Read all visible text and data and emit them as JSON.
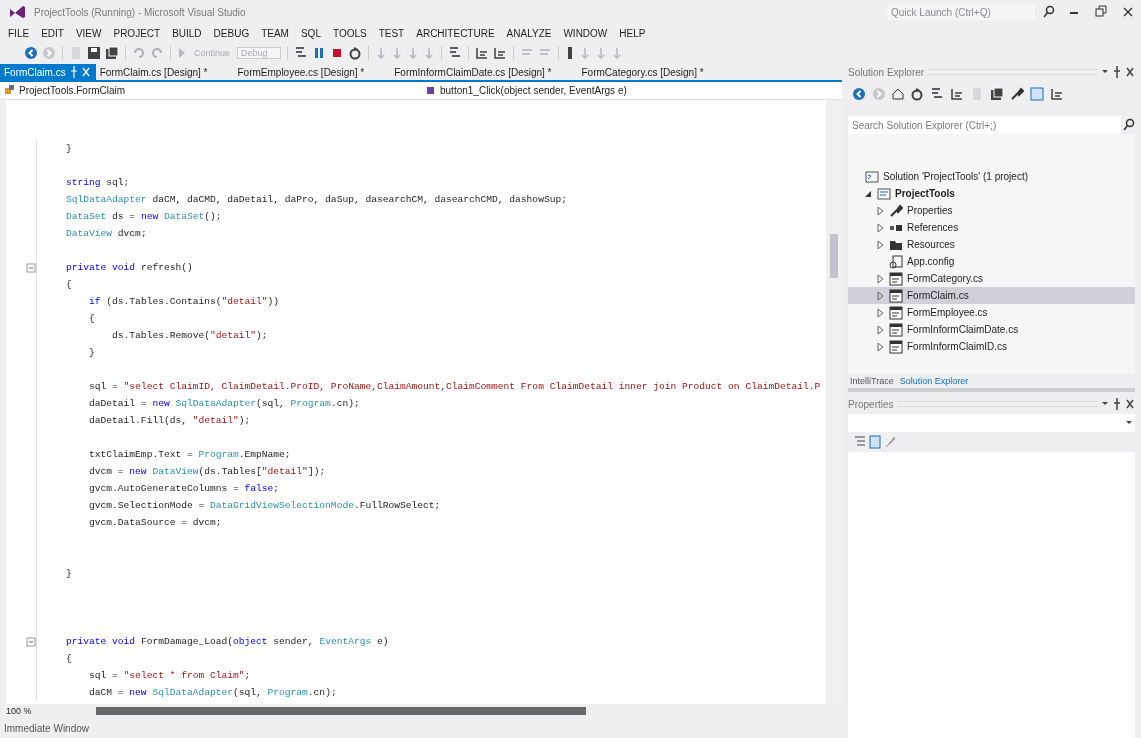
{
  "window": {
    "title": "ProjectTools (Running) - Microsoft Visual Studio",
    "quick_launch": {
      "placeholder": "Quick Launch (Ctrl+Q)"
    }
  },
  "menu": [
    "FILE",
    "EDIT",
    "VIEW",
    "PROJECT",
    "BUILD",
    "DEBUG",
    "TEAM",
    "SQL",
    "TOOLS",
    "TEST",
    "ARCHITECTURE",
    "ANALYZE",
    "WINDOW",
    "HELP"
  ],
  "toolbar": {
    "items": [
      {
        "kind": "back"
      },
      {
        "kind": "forward"
      },
      {
        "kind": "sep"
      },
      {
        "kind": "new"
      },
      {
        "kind": "save"
      },
      {
        "kind": "save-all"
      },
      {
        "kind": "sep"
      },
      {
        "kind": "undo"
      },
      {
        "kind": "redo"
      },
      {
        "kind": "sep"
      },
      {
        "kind": "continue",
        "label": "Continue",
        "disabled": true
      },
      {
        "kind": "combo",
        "label": "Debug",
        "disabled": true
      },
      {
        "kind": "sep"
      },
      {
        "kind": "process"
      },
      {
        "kind": "pause"
      },
      {
        "kind": "stop"
      },
      {
        "kind": "restart"
      },
      {
        "kind": "sep"
      },
      {
        "kind": "step"
      },
      {
        "kind": "step"
      },
      {
        "kind": "step"
      },
      {
        "kind": "step"
      },
      {
        "kind": "sep"
      },
      {
        "kind": "process"
      },
      {
        "kind": "sep"
      },
      {
        "kind": "outline"
      },
      {
        "kind": "outline"
      },
      {
        "kind": "sep"
      },
      {
        "kind": "comment"
      },
      {
        "kind": "comment"
      },
      {
        "kind": "sep"
      },
      {
        "kind": "bookmark"
      },
      {
        "kind": "step"
      },
      {
        "kind": "step"
      },
      {
        "kind": "step"
      }
    ]
  },
  "tabs": [
    {
      "label": "FormClaim.cs",
      "selected": true
    },
    {
      "label": "FormClaim.cs [Design]",
      "selected": false,
      "marker": "*"
    },
    {
      "label": "FormEmployee.cs [Design]",
      "selected": false,
      "marker": "*"
    },
    {
      "label": "FormInformClaimDate.cs [Design]",
      "selected": false,
      "marker": "*"
    },
    {
      "label": "FormCategory.cs [Design]",
      "selected": false,
      "marker": "*"
    }
  ],
  "navigation": {
    "class": "ProjectTools.FormClaim",
    "member": "button1_Click(object sender, EventArgs e)"
  },
  "code_lines": [
    {
      "kind": "code",
      "foldable": false,
      "tokens": [
        {
          "text": "    }",
          "kind": "plain"
        }
      ]
    },
    {
      "kind": "blank"
    },
    {
      "kind": "code",
      "foldable": false,
      "tokens": [
        {
          "text": "    string",
          "kind": "keyword"
        },
        {
          "text": " sql;",
          "kind": "plain"
        }
      ]
    },
    {
      "kind": "code",
      "foldable": false,
      "tokens": [
        {
          "text": "    SqlDataAdapter",
          "kind": "type"
        },
        {
          "text": " daCM, daCMD, daDetail, daPro, daSup, dasearchCM, dasearchCMD, dashowSup;",
          "kind": "plain"
        }
      ]
    },
    {
      "kind": "code",
      "foldable": false,
      "tokens": [
        {
          "text": "    DataSet",
          "kind": "type"
        },
        {
          "text": " ds = ",
          "kind": "plain"
        },
        {
          "text": "new",
          "kind": "keyword"
        },
        {
          "text": " DataSet",
          "kind": "type"
        },
        {
          "text": "();",
          "kind": "plain"
        }
      ]
    },
    {
      "kind": "code",
      "foldable": false,
      "tokens": [
        {
          "text": "    DataView",
          "kind": "type"
        },
        {
          "text": " dvcm;",
          "kind": "plain"
        }
      ]
    },
    {
      "kind": "blank"
    },
    {
      "kind": "code",
      "foldable": true,
      "tokens": [
        {
          "text": "    private void",
          "kind": "keyword"
        },
        {
          "text": " refresh()",
          "kind": "plain"
        }
      ]
    },
    {
      "kind": "code",
      "foldable": false,
      "tokens": [
        {
          "text": "    {",
          "kind": "plain"
        }
      ]
    },
    {
      "kind": "code",
      "foldable": false,
      "tokens": [
        {
          "text": "        if",
          "kind": "keyword"
        },
        {
          "text": " (ds.Tables.Contains(",
          "kind": "plain"
        },
        {
          "text": "\"detail\"",
          "kind": "string"
        },
        {
          "text": "))",
          "kind": "plain"
        }
      ]
    },
    {
      "kind": "code",
      "foldable": false,
      "tokens": [
        {
          "text": "        {",
          "kind": "plain"
        }
      ]
    },
    {
      "kind": "code",
      "foldable": false,
      "tokens": [
        {
          "text": "            ds.Tables.Remove(",
          "kind": "plain"
        },
        {
          "text": "\"detail\"",
          "kind": "string"
        },
        {
          "text": ");",
          "kind": "plain"
        }
      ]
    },
    {
      "kind": "code",
      "foldable": false,
      "tokens": [
        {
          "text": "        }",
          "kind": "plain"
        }
      ]
    },
    {
      "kind": "blank"
    },
    {
      "kind": "code",
      "foldable": false,
      "tokens": [
        {
          "text": "        sql = ",
          "kind": "plain"
        },
        {
          "text": "\"select ClaimID, ClaimDetail.ProID, ProName,ClaimAmount,ClaimComment From ClaimDetail inner join Product on ClaimDetail.P",
          "kind": "string"
        }
      ]
    },
    {
      "kind": "code",
      "foldable": false,
      "tokens": [
        {
          "text": "        daDetail = ",
          "kind": "plain"
        },
        {
          "text": "new",
          "kind": "keyword"
        },
        {
          "text": " SqlDataAdapter",
          "kind": "type"
        },
        {
          "text": "(sql, ",
          "kind": "plain"
        },
        {
          "text": "Program",
          "kind": "type"
        },
        {
          "text": ".cn);",
          "kind": "plain"
        }
      ]
    },
    {
      "kind": "code",
      "foldable": false,
      "tokens": [
        {
          "text": "        daDetail.Fill(ds, ",
          "kind": "plain"
        },
        {
          "text": "\"detail\"",
          "kind": "string"
        },
        {
          "text": ");",
          "kind": "plain"
        }
      ]
    },
    {
      "kind": "blank"
    },
    {
      "kind": "code",
      "foldable": false,
      "tokens": [
        {
          "text": "        txtClaimEmp.Text = ",
          "kind": "plain"
        },
        {
          "text": "Program",
          "kind": "type"
        },
        {
          "text": ".EmpName;",
          "kind": "plain"
        }
      ]
    },
    {
      "kind": "code",
      "foldable": false,
      "tokens": [
        {
          "text": "        dvcm = ",
          "kind": "plain"
        },
        {
          "text": "new",
          "kind": "keyword"
        },
        {
          "text": " DataView",
          "kind": "type"
        },
        {
          "text": "(ds.Tables[",
          "kind": "plain"
        },
        {
          "text": "\"detail\"",
          "kind": "string"
        },
        {
          "text": "]);",
          "kind": "plain"
        }
      ]
    },
    {
      "kind": "code",
      "foldable": false,
      "tokens": [
        {
          "text": "        gvcm.AutoGenerateColumns = ",
          "kind": "plain"
        },
        {
          "text": "false",
          "kind": "keyword"
        },
        {
          "text": ";",
          "kind": "plain"
        }
      ]
    },
    {
      "kind": "code",
      "foldable": false,
      "tokens": [
        {
          "text": "        gvcm.SelectionMode = ",
          "kind": "plain"
        },
        {
          "text": "DataGridViewSelectionMode",
          "kind": "type"
        },
        {
          "text": ".FullRowSelect;",
          "kind": "plain"
        }
      ]
    },
    {
      "kind": "code",
      "foldable": false,
      "tokens": [
        {
          "text": "        gvcm.DataSource = dvcm;",
          "kind": "plain"
        }
      ]
    },
    {
      "kind": "blank"
    },
    {
      "kind": "blank"
    },
    {
      "kind": "code",
      "foldable": false,
      "tokens": [
        {
          "text": "    }",
          "kind": "plain"
        }
      ]
    },
    {
      "kind": "blank"
    },
    {
      "kind": "blank"
    },
    {
      "kind": "blank"
    },
    {
      "kind": "code",
      "foldable": true,
      "tokens": [
        {
          "text": "    private void",
          "kind": "keyword"
        },
        {
          "text": " FormDamage_Load(",
          "kind": "plain"
        },
        {
          "text": "object",
          "kind": "keyword"
        },
        {
          "text": " sender, ",
          "kind": "plain"
        },
        {
          "text": "EventArgs",
          "kind": "type"
        },
        {
          "text": " e)",
          "kind": "plain"
        }
      ]
    },
    {
      "kind": "code",
      "foldable": false,
      "tokens": [
        {
          "text": "    {",
          "kind": "plain"
        }
      ]
    },
    {
      "kind": "code",
      "foldable": false,
      "tokens": [
        {
          "text": "        sql = ",
          "kind": "plain"
        },
        {
          "text": "\"select * from Claim\"",
          "kind": "string"
        },
        {
          "text": ";",
          "kind": "plain"
        }
      ]
    },
    {
      "kind": "code",
      "foldable": false,
      "tokens": [
        {
          "text": "        daCM = ",
          "kind": "plain"
        },
        {
          "text": "new",
          "kind": "keyword"
        },
        {
          "text": " SqlDataAdapter",
          "kind": "type"
        },
        {
          "text": "(sql, ",
          "kind": "plain"
        },
        {
          "text": "Program",
          "kind": "type"
        },
        {
          "text": ".cn);",
          "kind": "plain"
        }
      ]
    }
  ],
  "zoom": "100 %",
  "bottom_tab": "Immediate Window",
  "solution_explorer": {
    "title": "Solution Explorer",
    "search": {
      "placeholder": "Search Solution Explorer (Ctrl+;)"
    },
    "tree": [
      {
        "label": "Solution 'ProjectTools' (1 project)",
        "kind": "solution",
        "expandable": false,
        "selected": false,
        "bold": false,
        "children": [
          {
            "label": "ProjectTools",
            "kind": "project",
            "expandable": true,
            "expanded": true,
            "selected": false,
            "bold": true,
            "children": [
              {
                "label": "Properties",
                "kind": "properties",
                "expandable": true,
                "expanded": false,
                "selected": false,
                "bold": false
              },
              {
                "label": "References",
                "kind": "references",
                "expandable": true,
                "expanded": false,
                "selected": false,
                "bold": false
              },
              {
                "label": "Resources",
                "kind": "folder",
                "expandable": true,
                "expanded": false,
                "selected": false,
                "bold": false
              },
              {
                "label": "App.config",
                "kind": "config",
                "expandable": false,
                "selected": false,
                "bold": false
              },
              {
                "label": "FormCategory.cs",
                "kind": "form",
                "expandable": true,
                "expanded": false,
                "selected": false,
                "bold": false
              },
              {
                "label": "FormClaim.cs",
                "kind": "form",
                "expandable": true,
                "expanded": false,
                "selected": true,
                "bold": false
              },
              {
                "label": "FormEmployee.cs",
                "kind": "form",
                "expandable": true,
                "expanded": false,
                "selected": false,
                "bold": false
              },
              {
                "label": "FormInformClaimDate.cs",
                "kind": "form",
                "expandable": true,
                "expanded": false,
                "selected": false,
                "bold": false
              },
              {
                "label": "FormInformClaimID.cs",
                "kind": "form",
                "expandable": true,
                "expanded": false,
                "selected": false,
                "bold": false
              }
            ]
          }
        ]
      }
    ],
    "tabs": [
      {
        "label": "IntelliTrace",
        "selected": false
      },
      {
        "label": "Solution Explorer",
        "selected": true
      }
    ]
  },
  "properties": {
    "title": "Properties"
  }
}
